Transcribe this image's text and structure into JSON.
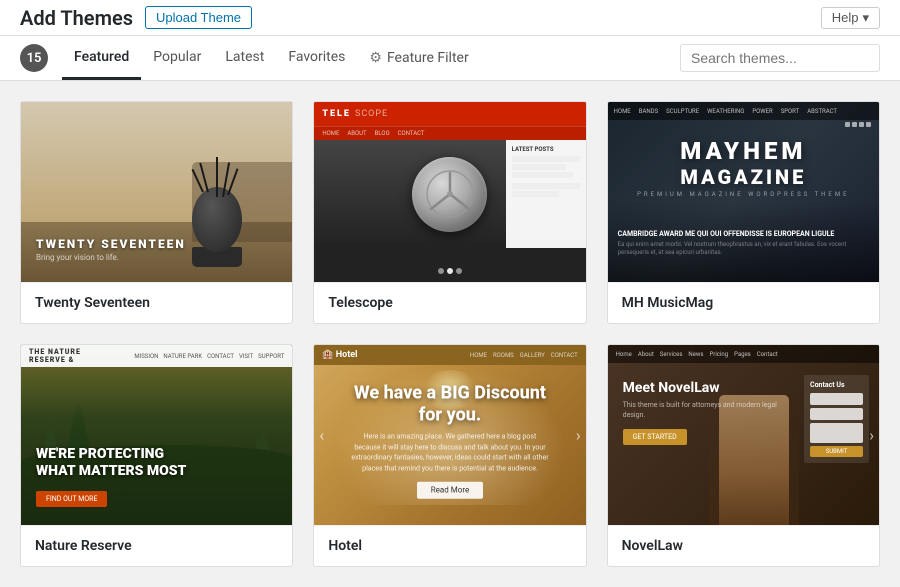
{
  "topbar": {
    "title": "Add Themes",
    "upload_btn": "Upload Theme",
    "help_btn": "Help"
  },
  "navbar": {
    "count": "15",
    "tabs": [
      {
        "id": "featured",
        "label": "Featured",
        "active": true
      },
      {
        "id": "popular",
        "label": "Popular",
        "active": false
      },
      {
        "id": "latest",
        "label": "Latest",
        "active": false
      },
      {
        "id": "favorites",
        "label": "Favorites",
        "active": false
      }
    ],
    "feature_filter": "Feature Filter",
    "search_placeholder": "Search themes..."
  },
  "themes": [
    {
      "id": "twenty-seventeen",
      "name": "Twenty Seventeen",
      "preview_type": "twenty-seventeen"
    },
    {
      "id": "telescope",
      "name": "Telescope",
      "preview_type": "telescope"
    },
    {
      "id": "mh-musicmag",
      "name": "MH MusicMag",
      "preview_type": "musicmag"
    },
    {
      "id": "nature-reserve",
      "name": "Nature Reserve",
      "preview_type": "nature"
    },
    {
      "id": "hotel",
      "name": "Hotel",
      "preview_type": "hotel"
    },
    {
      "id": "novellaw",
      "name": "NovelLaw",
      "preview_type": "novellaw"
    }
  ]
}
